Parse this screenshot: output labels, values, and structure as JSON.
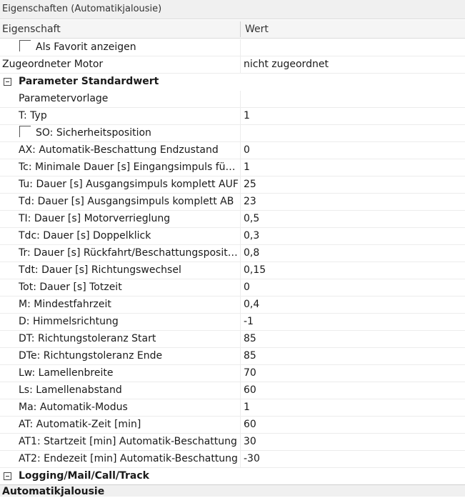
{
  "window_title": "Eigenschaften (Automatikjalousie)",
  "header": {
    "col_property": "Eigenschaft",
    "col_value": "Wert"
  },
  "top_rows": [
    {
      "name": "Als Favorit anzeigen",
      "value": ""
    },
    {
      "name": "Zugeordneter Motor",
      "value": "nicht zugeordnet"
    }
  ],
  "section1": {
    "title": "Parameter Standardwert",
    "rows": [
      {
        "name": "Parametervorlage",
        "value": ""
      },
      {
        "name": "T: Typ",
        "value": "1"
      },
      {
        "name": "SO: Sicherheitsposition",
        "value": ""
      },
      {
        "name": "AX: Automatik-Beschattung Endzustand",
        "value": "0"
      },
      {
        "name": "Tc: Minimale Dauer [s] Eingangsimpuls für K...",
        "value": "1"
      },
      {
        "name": "Tu: Dauer [s] Ausgangsimpuls komplett AUF",
        "value": "25"
      },
      {
        "name": "Td: Dauer [s] Ausgangsimpuls komplett AB",
        "value": "23"
      },
      {
        "name": "TI: Dauer [s] Motorverrieglung",
        "value": "0,5"
      },
      {
        "name": "Tdc: Dauer [s] Doppelklick",
        "value": "0,3"
      },
      {
        "name": "Tr: Dauer [s] Rückfahrt/Beschattungsposition ...",
        "value": "0,8"
      },
      {
        "name": "Tdt: Dauer [s] Richtungswechsel",
        "value": "0,15"
      },
      {
        "name": "Tot: Dauer [s] Totzeit",
        "value": "0"
      },
      {
        "name": "M: Mindestfahrzeit",
        "value": "0,4"
      },
      {
        "name": "D: Himmelsrichtung",
        "value": "-1"
      },
      {
        "name": "DT: Richtungstoleranz Start",
        "value": "85"
      },
      {
        "name": "DTe: Richtungstoleranz Ende",
        "value": "85"
      },
      {
        "name": "Lw: Lamellenbreite",
        "value": "70"
      },
      {
        "name": "Ls: Lamellenabstand",
        "value": "60"
      },
      {
        "name": "Ma: Automatik-Modus",
        "value": "1"
      },
      {
        "name": "AT: Automatik-Zeit [min]",
        "value": "60"
      },
      {
        "name": "AT1: Startzeit [min] Automatik-Beschattung",
        "value": "30"
      },
      {
        "name": "AT2: Endezeit [min] Automatik-Beschattung",
        "value": "-30"
      }
    ]
  },
  "section2": {
    "title": "Logging/Mail/Call/Track"
  },
  "status_bar": {
    "title": "Automatikjalousie"
  }
}
